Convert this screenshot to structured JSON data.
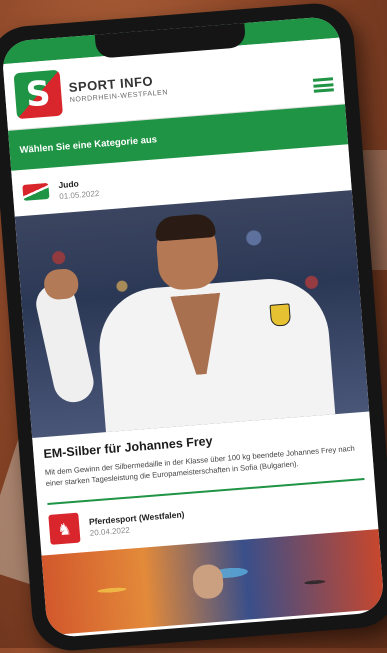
{
  "app": {
    "brand_title": "SPORT INFO",
    "brand_subtitle": "NORDRHEIN-WESTFALEN",
    "category_prompt": "Wählen Sie eine Kategorie aus"
  },
  "icons": {
    "logo": "sport-info-logo-icon",
    "menu": "hamburger-menu-icon",
    "judo": "judo-category-icon",
    "horse": "horse-category-icon"
  },
  "colors": {
    "brand_green": "#1e9444",
    "brand_red": "#d8262c"
  },
  "articles": [
    {
      "category": "Judo",
      "date": "01.05.2022",
      "title": "EM-Silber für Johannes Frey",
      "text": "Mit dem Gewinn der Silbermedaille in der Klasse über 100 kg beendete Johannes Frey nach einer starken Tagesleistung die Europameisterschaften in Sofia (Bulgarien)."
    },
    {
      "category": "Pferdesport (Westfalen)",
      "date": "20.04.2022"
    }
  ]
}
